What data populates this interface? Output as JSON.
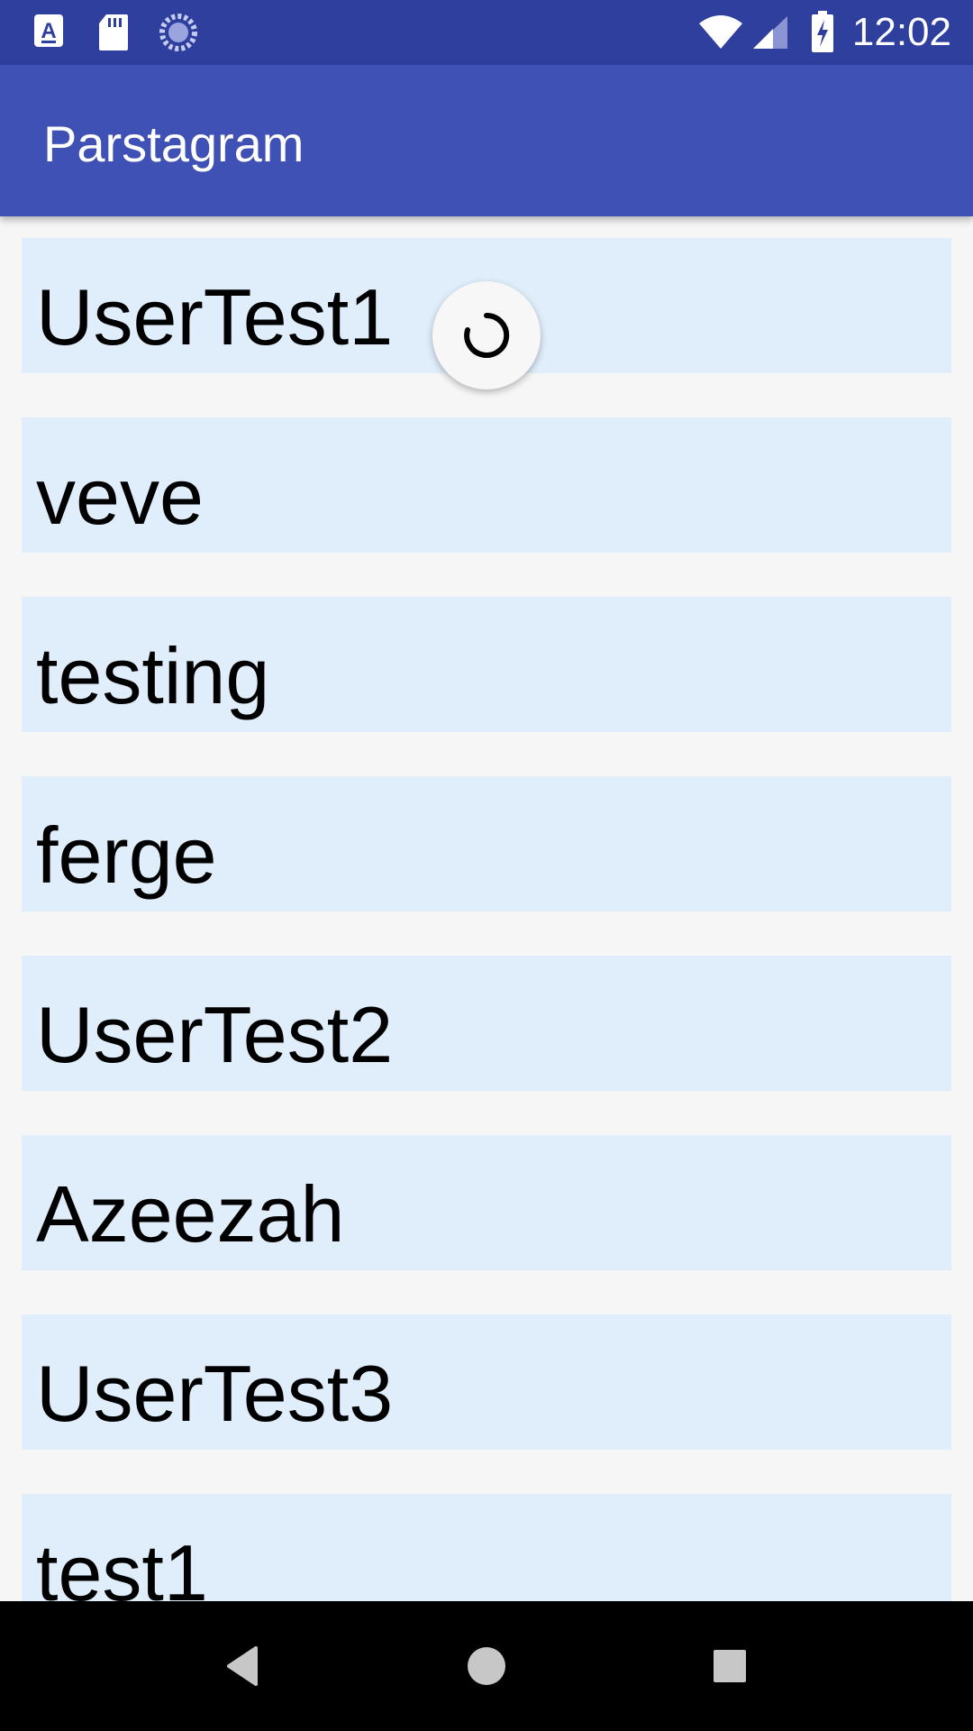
{
  "status_bar": {
    "time": "12:02",
    "left_icons": [
      "font-a-icon",
      "sd-card-icon",
      "sync-icon"
    ],
    "right_icons": [
      "wifi-icon",
      "cell-signal-icon",
      "battery-charging-icon"
    ]
  },
  "app_bar": {
    "title": "Parstagram"
  },
  "list": {
    "items": [
      {
        "label": "UserTest1"
      },
      {
        "label": "veve"
      },
      {
        "label": "testing"
      },
      {
        "label": "ferge"
      },
      {
        "label": "UserTest2"
      },
      {
        "label": "Azeezah"
      },
      {
        "label": "UserTest3"
      },
      {
        "label": "test1"
      }
    ]
  },
  "colors": {
    "status_bar": "#2f3f9e",
    "app_bar": "#3f51b5",
    "list_item_bg": "#e0eefb",
    "nav_bar": "#000000"
  },
  "nav_bar": {
    "buttons": [
      "back-icon",
      "home-icon",
      "recents-icon"
    ]
  }
}
